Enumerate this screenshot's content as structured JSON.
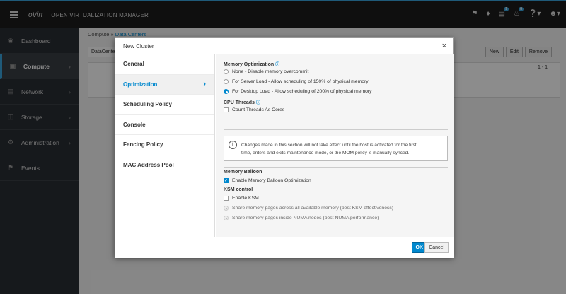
{
  "topbar": {
    "brand": "oVirt",
    "product": "OPEN VIRTUALIZATION MANAGER",
    "badge_tasks": "9",
    "badge_alerts": "8"
  },
  "sidebar": {
    "items": [
      {
        "label": "Dashboard"
      },
      {
        "label": "Compute"
      },
      {
        "label": "Network"
      },
      {
        "label": "Storage"
      },
      {
        "label": "Administration"
      },
      {
        "label": "Events"
      }
    ]
  },
  "content": {
    "crumb_root": "Compute",
    "crumb_sep": "»",
    "crumb_page": "Data Centers",
    "select_value": "DataCenter",
    "btn_new": "New",
    "btn_edit": "Edit",
    "btn_remove": "Remove",
    "pager": "1 - 1"
  },
  "modal": {
    "title": "New Cluster",
    "tabs": [
      "General",
      "Optimization",
      "Scheduling Policy",
      "Console",
      "Fencing Policy",
      "MAC Address Pool"
    ],
    "memopt_title": "Memory Optimization",
    "memopt_none": "None - Disable memory overcommit",
    "memopt_server": "For Server Load - Allow scheduling of 150% of physical memory",
    "memopt_desktop": "For Desktop Load - Allow scheduling of 200% of physical memory",
    "cpu_title": "CPU Threads",
    "cpu_count": "Count Threads As Cores",
    "notice_line1": "Changes made in this section will not take effect until the host is activated for the first",
    "notice_line2": "time, enters and exits maintenance mode, or the MOM policy is manually synced.",
    "balloon_title": "Memory Balloon",
    "balloon_enable": "Enable Memory Balloon Optimization",
    "ksm_title": "KSM control",
    "ksm_enable": "Enable KSM",
    "ksm_all": "Share memory pages across all available memory (best KSM effectiveness)",
    "ksm_numa": "Share memory pages inside NUMA nodes (best NUMA performance)",
    "ok": "OK",
    "cancel": "Cancel"
  }
}
